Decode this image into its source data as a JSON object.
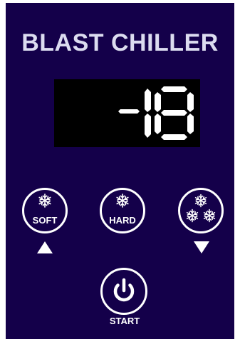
{
  "panel": {
    "title": "BLAST CHILLER",
    "background_color": "#14004a",
    "title_color": "#dcdcf0"
  },
  "display": {
    "value": "-18",
    "segment_color": "#ffffff"
  },
  "buttons": {
    "soft": {
      "label": "SOFT",
      "icon": "snowflake-icon",
      "indicator": "up-arrow-icon"
    },
    "hard": {
      "label": "HARD",
      "icon": "snowflake-icon"
    },
    "deep": {
      "icon": "triple-snowflake-icon",
      "indicator": "down-arrow-icon"
    },
    "start": {
      "label": "START",
      "icon": "power-icon"
    }
  }
}
